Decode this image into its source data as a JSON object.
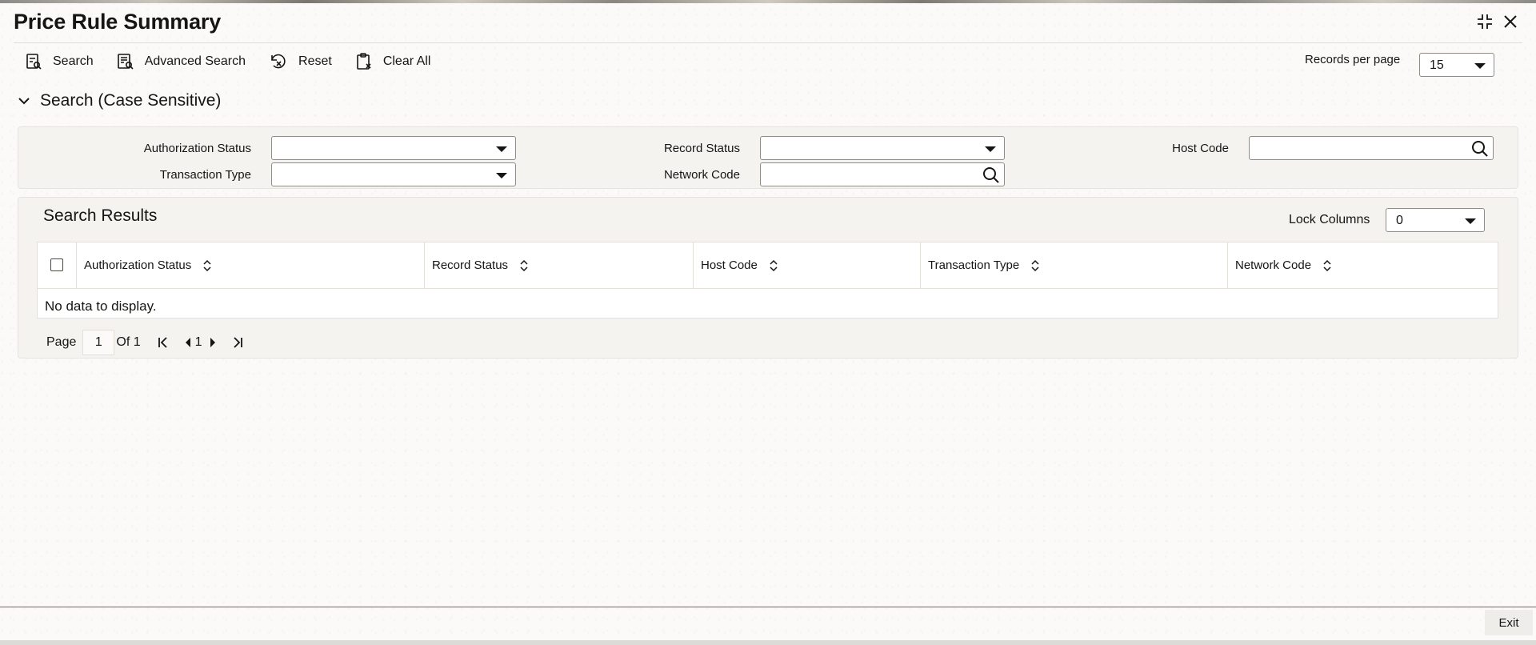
{
  "window": {
    "title": "Price Rule Summary",
    "minimize_icon": "collapse-icon",
    "close_icon": "close-icon"
  },
  "toolbar": {
    "search_label": "Search",
    "advanced_search_label": "Advanced Search",
    "reset_label": "Reset",
    "clear_all_label": "Clear All",
    "records_per_page_label": "Records per page",
    "records_per_page_value": "15"
  },
  "search_section": {
    "title": "Search (Case Sensitive)",
    "fields": {
      "authorization_status": {
        "label": "Authorization Status",
        "value": ""
      },
      "record_status": {
        "label": "Record Status",
        "value": ""
      },
      "host_code": {
        "label": "Host Code",
        "value": ""
      },
      "transaction_type": {
        "label": "Transaction Type",
        "value": ""
      },
      "network_code": {
        "label": "Network Code",
        "value": ""
      }
    }
  },
  "results": {
    "title": "Search Results",
    "lock_columns_label": "Lock Columns",
    "lock_columns_value": "0",
    "columns": [
      "Authorization Status",
      "Record Status",
      "Host Code",
      "Transaction Type",
      "Network Code"
    ],
    "empty_message": "No data to display."
  },
  "pager": {
    "page_label": "Page",
    "current_page": "1",
    "of_label": "Of 1",
    "page_number": "1"
  },
  "footer": {
    "exit_label": "Exit"
  }
}
